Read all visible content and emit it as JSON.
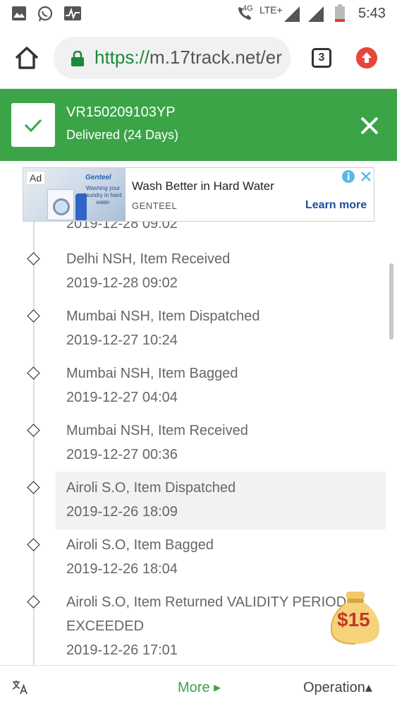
{
  "statusbar": {
    "network_label": "4G",
    "lte_label": "LTE+",
    "time": "5:43"
  },
  "browser": {
    "url_scheme": "https://",
    "url_host": "m.17track.net/er",
    "tab_count": "3"
  },
  "banner": {
    "tracking_number": "VR150209103YP",
    "status": "Delivered (24 Days)"
  },
  "ad": {
    "badge": "Ad",
    "brand_logo_text": "Genteel",
    "image_tagline": "Washing your laundry in hard water",
    "title": "Wash Better in Hard Water",
    "advertiser": "GENTEEL",
    "cta": "Learn more"
  },
  "timeline": {
    "partial_time": "2019-12-28 09:02",
    "events": [
      {
        "description": "Delhi NSH, Item Received",
        "time": "2019-12-28 09:02"
      },
      {
        "description": "Mumbai NSH, Item Dispatched",
        "time": "2019-12-27 10:24"
      },
      {
        "description": "Mumbai NSH, Item Bagged",
        "time": "2019-12-27 04:04"
      },
      {
        "description": "Mumbai NSH, Item Received",
        "time": "2019-12-27 00:36"
      },
      {
        "description": "Airoli S.O, Item Dispatched",
        "time": "2019-12-26 18:09"
      },
      {
        "description": "Airoli S.O, Item Bagged",
        "time": "2019-12-26 18:04"
      },
      {
        "description": "Airoli S.O, Item Returned VALIDITY PERIOD",
        "description_line2": "EXCEEDED",
        "time": "2019-12-26 17:01"
      }
    ]
  },
  "reward": {
    "amount": "$15"
  },
  "bottom_bar": {
    "more_label": "More ▸",
    "operation_label": "Operation▴"
  },
  "colors": {
    "brand_green": "#3aa447",
    "close_white": "#ffffff",
    "update_red": "#e8453c"
  }
}
